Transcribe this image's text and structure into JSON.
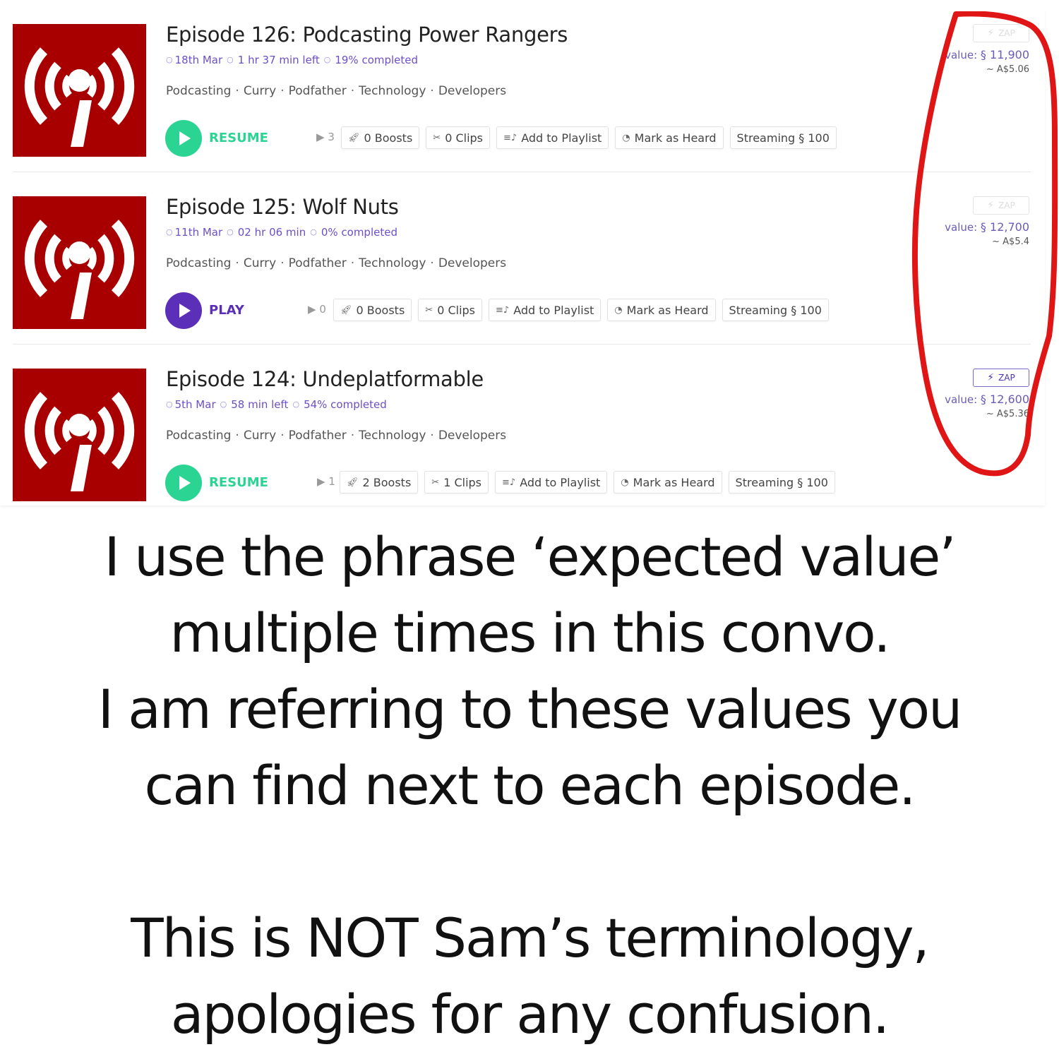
{
  "episodes": [
    {
      "title": "Episode 126: Podcasting Power Rangers",
      "date": "18th Mar",
      "duration": "1 hr 37 min left",
      "progress": "19% completed",
      "tags": [
        "Podcasting",
        "Curry",
        "Podfather",
        "Technology",
        "Developers"
      ],
      "play_state": "RESUME",
      "play_color": "#2bd492",
      "plays": "3",
      "boosts": "0 Boosts",
      "clips": "0 Clips",
      "playlist": "Add to Playlist",
      "heard": "Mark as Heard",
      "streaming": "Streaming § 100",
      "zap": "ZAP",
      "zap_enabled": false,
      "value_label": "value:",
      "value": "§ 11,900",
      "fiat": "~ A$5.06"
    },
    {
      "title": "Episode 125: Wolf Nuts",
      "date": "11th Mar",
      "duration": "02 hr 06 min",
      "progress": "0% completed",
      "tags": [
        "Podcasting",
        "Curry",
        "Podfather",
        "Technology",
        "Developers"
      ],
      "play_state": "PLAY",
      "play_color": "#5b2fb8",
      "plays": "0",
      "boosts": "0 Boosts",
      "clips": "0 Clips",
      "playlist": "Add to Playlist",
      "heard": "Mark as Heard",
      "streaming": "Streaming § 100",
      "zap": "ZAP",
      "zap_enabled": false,
      "value_label": "value:",
      "value": "§ 12,700",
      "fiat": "~ A$5.4"
    },
    {
      "title": "Episode 124: Undeplatformable",
      "date": "5th Mar",
      "duration": "58 min left",
      "progress": "54% completed",
      "tags": [
        "Podcasting",
        "Curry",
        "Podfather",
        "Technology",
        "Developers"
      ],
      "play_state": "RESUME",
      "play_color": "#2bd492",
      "plays": "1",
      "boosts": "2 Boosts",
      "clips": "1 Clips",
      "playlist": "Add to Playlist",
      "heard": "Mark as Heard",
      "streaming": "Streaming § 100",
      "zap": "ZAP",
      "zap_enabled": true,
      "value_label": "value:",
      "value": "§ 12,600",
      "fiat": "~ A$5.36"
    }
  ],
  "icons": {
    "artwork": "podcast-broadcast-icon",
    "play": "play-icon",
    "plays": "play-count-icon",
    "boosts": "rocket-icon",
    "clips": "scissors-icon",
    "playlist": "playlist-add-icon",
    "heard": "ear-icon",
    "zap": "lightning-bolt-icon"
  },
  "annotation": {
    "color": "#e01616",
    "shape": "hand-drawn-loop"
  },
  "caption": {
    "lines_1": [
      "I use the phrase ‘expected value’",
      "multiple times in this convo.",
      "I am referring to these values you",
      "can find next to each episode."
    ],
    "lines_2": [
      "This is NOT Sam’s terminology,",
      "apologies for any confusion."
    ]
  },
  "colors": {
    "artwork_bg": "#a80000",
    "accent_purple": "#6c4fc9",
    "resume_green": "#2bd492",
    "play_purple": "#5b2fb8"
  }
}
